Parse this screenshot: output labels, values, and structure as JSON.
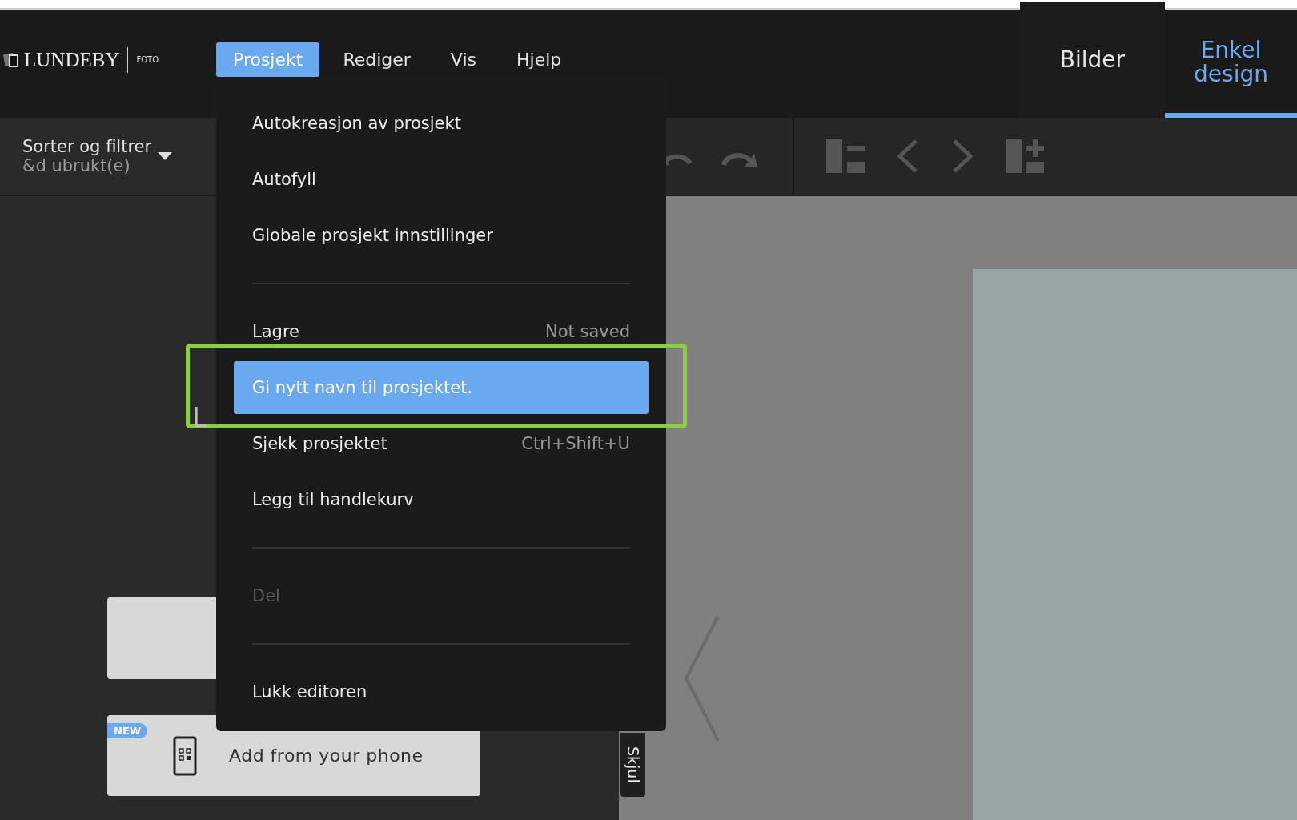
{
  "logo": {
    "name": "LUNDEBY",
    "sub": "FOTO"
  },
  "menu_bar": [
    {
      "label": "Prosjekt",
      "selected": true
    },
    {
      "label": "Rediger",
      "selected": false
    },
    {
      "label": "Vis",
      "selected": false
    },
    {
      "label": "Hjelp",
      "selected": false
    }
  ],
  "view_tabs": [
    {
      "label": "Bilder",
      "selected": false
    },
    {
      "label": "Enkel design",
      "selected": true
    }
  ],
  "sort_filter": {
    "label": "Sorter og filtrer",
    "sub": "&d ubrukt(e)"
  },
  "left_panel": {
    "partial_heading": "L",
    "phone_card": {
      "badge": "NEW",
      "label": "Add from your phone"
    }
  },
  "hide_tab": "Skjul",
  "project_menu": {
    "items": [
      {
        "kind": "item",
        "label": "Autokreasjon av prosjekt",
        "disabled": false,
        "selected": false
      },
      {
        "kind": "item",
        "label": "Autofyll",
        "disabled": false,
        "selected": false
      },
      {
        "kind": "item",
        "label": "Globale prosjekt innstillinger",
        "disabled": false,
        "selected": false
      },
      {
        "kind": "separator"
      },
      {
        "kind": "item",
        "label": "Lagre",
        "shortcut": "Not saved",
        "disabled": false,
        "selected": false
      },
      {
        "kind": "item",
        "label": "Gi nytt navn til prosjektet.",
        "disabled": false,
        "selected": true,
        "outlined": true
      },
      {
        "kind": "item",
        "label": "Sjekk prosjektet",
        "shortcut": "Ctrl+Shift+U",
        "disabled": false,
        "selected": false
      },
      {
        "kind": "item",
        "label": "Legg til handlekurv",
        "disabled": false,
        "selected": false
      },
      {
        "kind": "separator"
      },
      {
        "kind": "item",
        "label": "Del",
        "disabled": true,
        "selected": false
      },
      {
        "kind": "separator"
      },
      {
        "kind": "item",
        "label": "Lukk editoren",
        "disabled": false,
        "selected": false
      }
    ]
  }
}
